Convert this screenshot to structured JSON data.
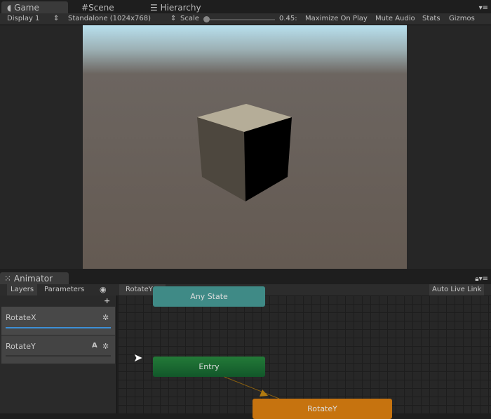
{
  "tabs": [
    {
      "label": "Game",
      "icon": "pacman-icon"
    },
    {
      "label": "Scene",
      "icon": "grid-icon"
    },
    {
      "label": "Hierarchy",
      "icon": "list-icon"
    }
  ],
  "toolbar": {
    "display": "Display 1",
    "resolution": "Standalone (1024x768)",
    "scale_label": "Scale",
    "scale_value": "0.45:",
    "maximize": "Maximize On Play",
    "mute": "Mute Audio",
    "stats": "Stats",
    "gizmos": "Gizmos"
  },
  "animator": {
    "tab": "Animator",
    "layers_tab": "Layers",
    "parameters_tab": "Parameters",
    "breadcrumb": "RotateY",
    "auto_live_link": "Auto Live Link",
    "add": "+",
    "layers": [
      {
        "name": "RotateX"
      },
      {
        "name": "RotateY",
        "badge": "A"
      }
    ],
    "nodes": {
      "any_state": "Any State",
      "entry": "Entry",
      "rotate_y": "RotateY"
    }
  },
  "colors": {
    "accent": "#3d8fd6",
    "entry": "#1c6b30",
    "state": "#c6730f",
    "any": "#3f8a86"
  }
}
